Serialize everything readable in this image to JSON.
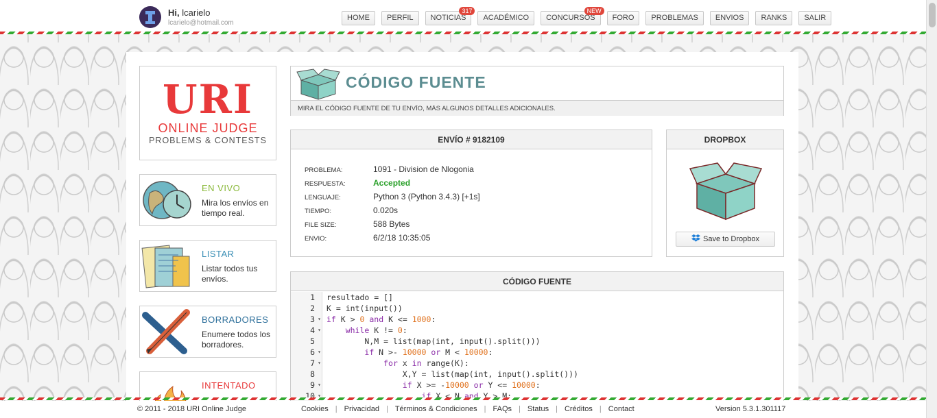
{
  "header": {
    "greeting_prefix": "Hi,",
    "username": "lcarielo",
    "email": "lcarielo@hotmail.com",
    "nav": [
      {
        "label": "HOME",
        "badge": null
      },
      {
        "label": "PERFIL",
        "badge": null
      },
      {
        "label": "NOTICIAS",
        "badge": "317"
      },
      {
        "label": "ACADÉMICO",
        "badge": null
      },
      {
        "label": "CONCURSOS",
        "badge": "NEW"
      },
      {
        "label": "FORO",
        "badge": null
      },
      {
        "label": "PROBLEMAS",
        "badge": null
      },
      {
        "label": "ENVIOS",
        "badge": null
      },
      {
        "label": "RANKS",
        "badge": null
      },
      {
        "label": "SALIR",
        "badge": null
      }
    ]
  },
  "logo": {
    "title": "URI",
    "line1": "ONLINE JUDGE",
    "line2": "PROBLEMS & CONTESTS"
  },
  "sidebar": [
    {
      "title": "EN VIVO",
      "desc": "Mira los envíos en tiempo real.",
      "color": "#8ab93a",
      "icon": "globe-clock-icon"
    },
    {
      "title": "LISTAR",
      "desc": "Listar todos tus envíos.",
      "color": "#3b8fb5",
      "icon": "list-papers-icon"
    },
    {
      "title": "BORRADORES",
      "desc": "Enumere todos los borradores.",
      "color": "#2b6e9a",
      "icon": "pencil-icon"
    },
    {
      "title": "INTENTADO",
      "desc": "",
      "color": "#e8393a",
      "icon": "fire-box-icon"
    }
  ],
  "page": {
    "title": "CÓDIGO FUENTE",
    "subtitle": "MIRA EL CÓDIGO FUENTE DE TU ENVÍO, MÁS ALGUNOS DETALLES ADICIONALES."
  },
  "submission": {
    "header": "ENVÍO # 9182109",
    "fields": [
      {
        "key": "PROBLEMA:",
        "value": "1091 - Division de Nlogonia",
        "status": false
      },
      {
        "key": "RESPUESTA:",
        "value": "Accepted",
        "status": true
      },
      {
        "key": "LENGUAJE:",
        "value": "Python 3 (Python 3.4.3) [+1s]",
        "status": false
      },
      {
        "key": "TIEMPO:",
        "value": "0.020s",
        "status": false
      },
      {
        "key": "FILE SIZE:",
        "value": "588 Bytes",
        "status": false
      },
      {
        "key": "ENVIO:",
        "value": "6/2/18 10:35:05",
        "status": false
      }
    ]
  },
  "dropbox": {
    "header": "DROPBOX",
    "save_label": "Save to Dropbox"
  },
  "code": {
    "header": "CÓDIGO FUENTE",
    "lines": [
      {
        "n": "1",
        "fold": false,
        "text": "resultado = []"
      },
      {
        "n": "2",
        "fold": false,
        "text": "K = int(input())"
      },
      {
        "n": "3",
        "fold": true,
        "text": "if K > 0 and K <= 1000:"
      },
      {
        "n": "4",
        "fold": true,
        "text": "    while K != 0:"
      },
      {
        "n": "5",
        "fold": false,
        "text": "        N,M = list(map(int, input().split()))"
      },
      {
        "n": "6",
        "fold": true,
        "text": "        if N >- 10000 or M < 10000:"
      },
      {
        "n": "7",
        "fold": true,
        "text": "            for x in range(K):"
      },
      {
        "n": "8",
        "fold": false,
        "text": "                X,Y = list(map(int, input().split()))"
      },
      {
        "n": "9",
        "fold": true,
        "text": "                if X >= -10000 or Y <= 10000:"
      },
      {
        "n": "10",
        "fold": true,
        "text": "                    if X < N and Y > M:"
      }
    ]
  },
  "footer": {
    "copyright": "© 2011 - 2018 URI Online Judge",
    "links": [
      "Cookies",
      "Privacidad",
      "Términos & Condiciones",
      "FAQs",
      "Status",
      "Créditos",
      "Contact"
    ],
    "version": "Version 5.3.1.301117"
  },
  "colors": {
    "accent_title": "#5c8d91",
    "accepted": "#2aa02a",
    "brand_red": "#e8393a",
    "badge": "#e0463b"
  }
}
